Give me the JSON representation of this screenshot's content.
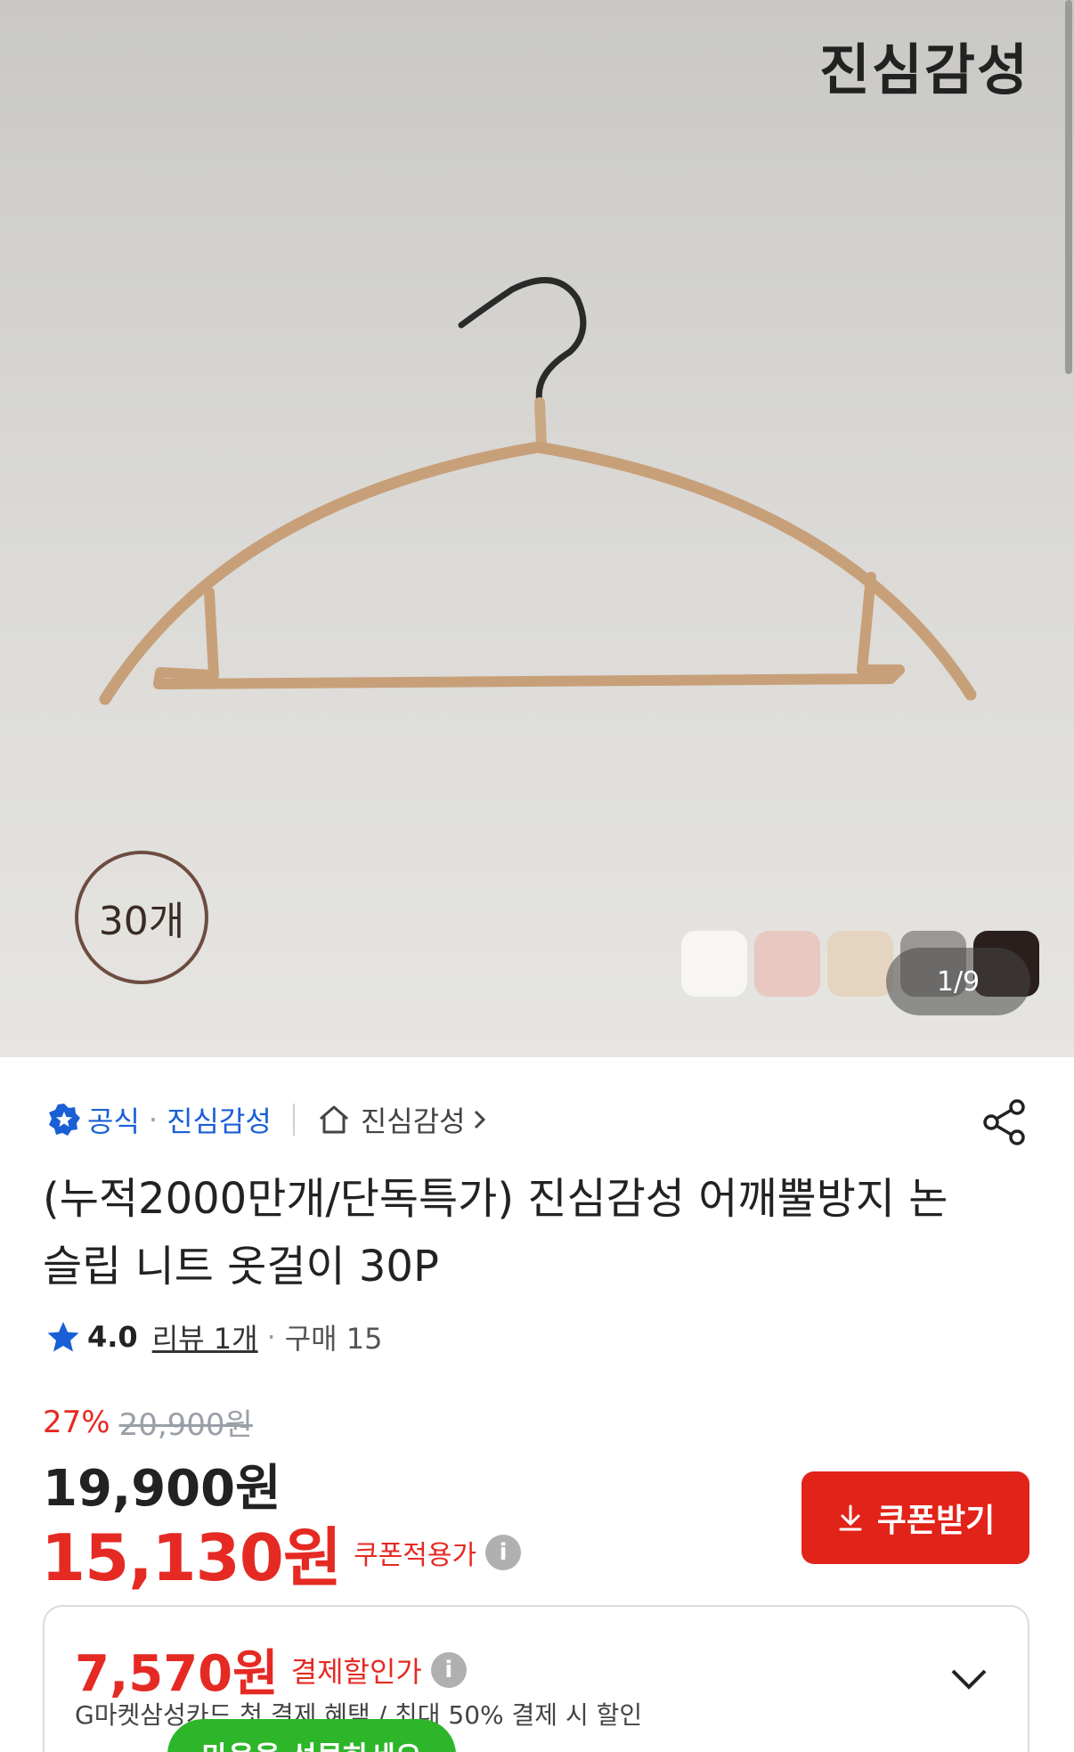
{
  "hero": {
    "brand_logo": "진심감성",
    "count_badge": "30개",
    "page_indicator": "1/9",
    "swatches": [
      "#f7f6f3",
      "#e8c8c0",
      "#e4d4c0",
      "#9a9894",
      "#2a1f1c"
    ]
  },
  "seller": {
    "official_label": "공식",
    "brand": "진심감성",
    "store_label": "진심감성"
  },
  "product": {
    "title": "(누적2000만개/단독특가) 진심감성 어깨뿔방지 논슬립 니트 옷걸이 30P"
  },
  "rating": {
    "score": "4.0",
    "review": "리뷰 1개",
    "separator": "·",
    "bought": "구매 15"
  },
  "price": {
    "discount": "27%",
    "original": "20,900원",
    "sale": "19,900원",
    "coupon_price": "15,130원",
    "coupon_label": "쿠폰적용가",
    "info": "i"
  },
  "coupon_button": {
    "label": "쿠폰받기"
  },
  "card_offer": {
    "price": "7,570원",
    "label": "결제할인가",
    "description": "G마켓삼성카드 첫 결제 혜택 / 최대 50% 결제 시 할인"
  },
  "gift": {
    "label": "마음을 선물하세요"
  }
}
